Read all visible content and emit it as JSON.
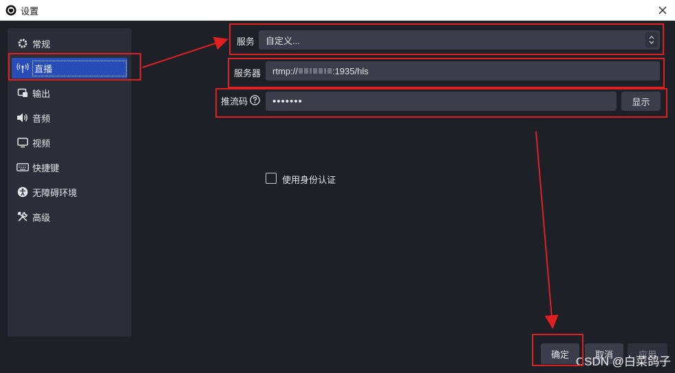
{
  "window": {
    "title": "设置"
  },
  "sidebar": {
    "items": [
      {
        "label": "常规",
        "icon": "gear-icon"
      },
      {
        "label": "直播",
        "icon": "antenna-icon"
      },
      {
        "label": "输出",
        "icon": "output-icon"
      },
      {
        "label": "音频",
        "icon": "speaker-icon"
      },
      {
        "label": "视频",
        "icon": "monitor-icon"
      },
      {
        "label": "快捷键",
        "icon": "keyboard-icon"
      },
      {
        "label": "无障碍环境",
        "icon": "accessibility-icon"
      },
      {
        "label": "高级",
        "icon": "tools-icon"
      }
    ],
    "active_index": 1
  },
  "stream": {
    "service_label": "服务",
    "service_value": "自定义...",
    "server_label": "服务器",
    "server_prefix": "rtmp://",
    "server_suffix": ":1935/hls",
    "key_label": "推流码",
    "key_value": "•••••••",
    "show_button": "显示",
    "auth_checkbox_label": "使用身份认证",
    "auth_checked": false
  },
  "footer": {
    "ok": "确定",
    "cancel": "取消",
    "apply": "应用"
  },
  "watermark": "CSDN @白菜鸽子",
  "colors": {
    "accent": "#284cb8",
    "annotation": "#e02020",
    "background": "#1e2028",
    "panel": "#2b2e38",
    "field": "#3b3e4a"
  }
}
